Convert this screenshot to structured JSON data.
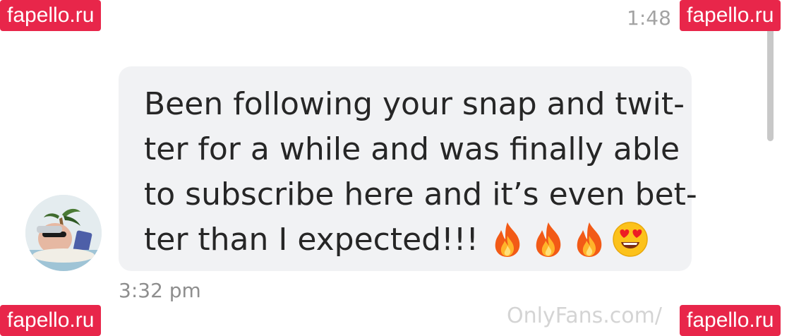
{
  "header": {
    "time": "1:48"
  },
  "message": {
    "lines": [
      "Been following your snap and twit-",
      "ter for a while and was finally able",
      "to subscribe here and it’s even bet-",
      "ter than I expected!!!"
    ],
    "emojis": [
      "fire-icon",
      "fire-icon",
      "fire-icon",
      "heart-eyes-icon"
    ],
    "timestamp": "3:32 pm"
  },
  "footer": {
    "brand_visible": "OnlyFans.com/"
  },
  "watermarks": {
    "top_left": "fapello.ru",
    "top_right": "fapello.ru",
    "bottom_left": "fapello.ru",
    "bottom_right": "fapello.ru"
  },
  "colors": {
    "bubble": "#f1f2f4",
    "watermark": "#e8264a",
    "text": "#262626",
    "muted": "#8e8e8e"
  }
}
